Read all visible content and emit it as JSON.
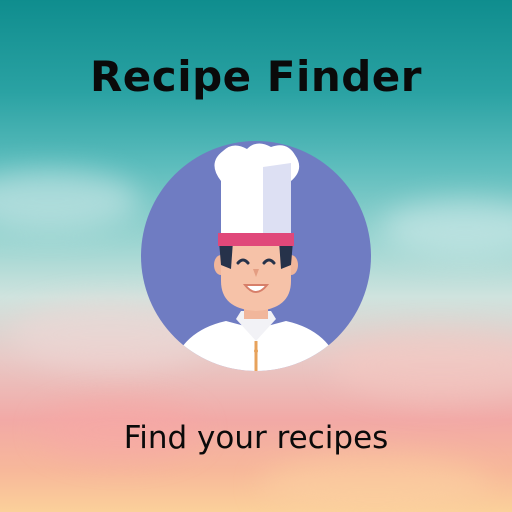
{
  "app": {
    "title": "Recipe Finder",
    "tagline": "Find your recipes"
  },
  "illustration": {
    "icon": "chef-icon",
    "circle_color": "#6f7cc2",
    "hat_color": "#ffffff",
    "hat_band_color": "#e0487a"
  },
  "colors": {
    "text": "#0a0a0a",
    "sky_top": "#0f8d8e",
    "sky_bottom": "#fbd09a"
  }
}
